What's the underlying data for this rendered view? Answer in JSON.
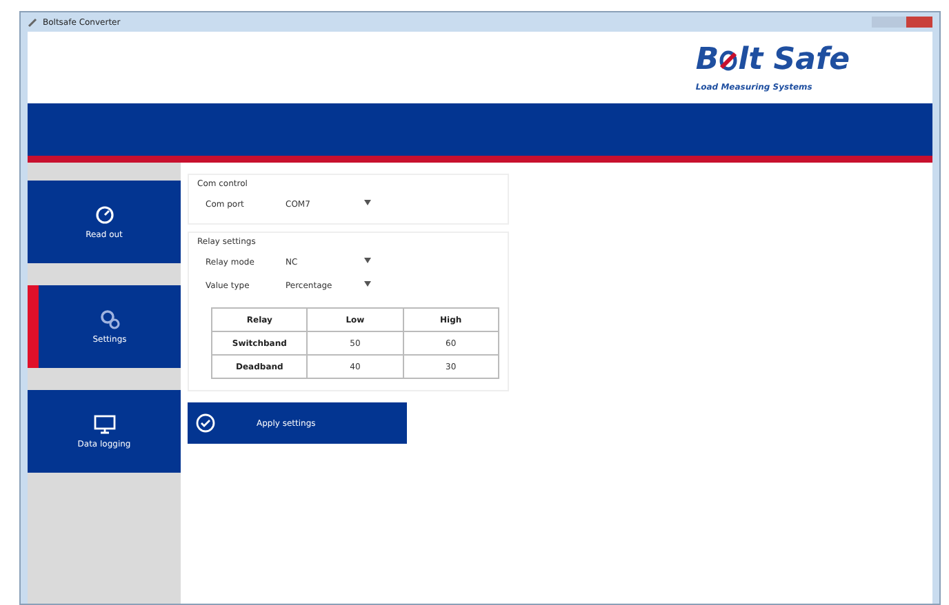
{
  "window": {
    "title": "Boltsafe Converter"
  },
  "logo": {
    "brand_start": "B",
    "brand_end": "lt Safe",
    "tagline": "Load Measuring Systems"
  },
  "sidebar": {
    "items": [
      {
        "label": "Read out",
        "kind": "gauge",
        "selected": false
      },
      {
        "label": "Settings",
        "kind": "gears",
        "selected": true
      },
      {
        "label": "Data logging",
        "kind": "monitor",
        "selected": false
      }
    ]
  },
  "com_control": {
    "title": "Com control",
    "fields": [
      {
        "label": "Com port",
        "value": "COM7"
      }
    ]
  },
  "relay_settings": {
    "title": "Relay settings",
    "fields": [
      {
        "label": "Relay mode",
        "value": "NC"
      },
      {
        "label": "Value type",
        "value": "Percentage"
      }
    ],
    "table": {
      "columns": [
        "Relay",
        "Low",
        "High"
      ],
      "rows": [
        [
          "Switchband",
          "50",
          "60"
        ],
        [
          "Deadband",
          "40",
          "30"
        ]
      ]
    }
  },
  "apply_button": {
    "label": "Apply settings"
  }
}
